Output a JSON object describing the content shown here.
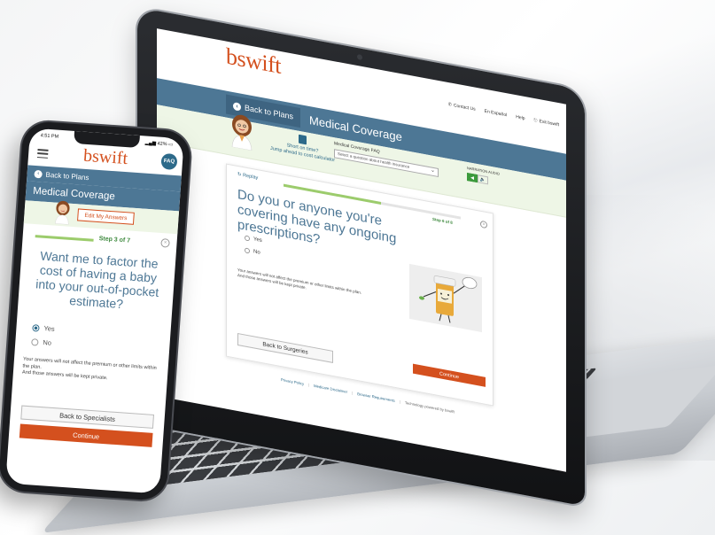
{
  "laptop": {
    "logo": "bswift",
    "top_links": [
      "Contact Us",
      "En Español",
      "Help",
      "Exit bswift"
    ],
    "back_label": "Back to Plans",
    "page_title": "Medical Coverage",
    "calc_line1": "Short on time?",
    "calc_line2": "Jump ahead to cost calculator",
    "faq_label": "Medical Coverage FAQ",
    "faq_placeholder": "Select a question about health insurance",
    "lang_label": "NARRATION AUDIO",
    "replay": "Replay",
    "step": "Step 6 of 8",
    "question": "Do you or anyone you're covering have any ongoing prescriptions?",
    "options": [
      "Yes",
      "No"
    ],
    "note_line1": "Your answers will not affect the premium or other limits within the plan.",
    "note_line2": "And those answers will be kept private.",
    "back_button": "Back to Surgeries",
    "continue_button": "Continue",
    "footer_links": [
      "Privacy Policy",
      "Medicare Disclaimer",
      "Browser Requirements"
    ],
    "powered_by": "Technology powered by bswift"
  },
  "phone": {
    "time": "4:51 PM",
    "battery": "42%",
    "logo": "bswift",
    "faq": "FAQ",
    "back_label": "Back to Plans",
    "page_title": "Medical Coverage",
    "edit_button": "Edit My Answers",
    "step": "Step 3 of 7",
    "question": "Want me to factor the cost of having a baby into your out-of-pocket estimate?",
    "options": [
      "Yes",
      "No"
    ],
    "note_line1": "Your answers will not affect the premium or other limits within the plan.",
    "note_line2": "And those answers will be kept private.",
    "back_button": "Back to Specialists",
    "continue_button": "Continue"
  },
  "colors": {
    "brand_orange": "#d4501e",
    "header_blue": "#4d7795",
    "accent_green": "#9ccc6c",
    "sub_bar_green": "#eef6e6"
  }
}
